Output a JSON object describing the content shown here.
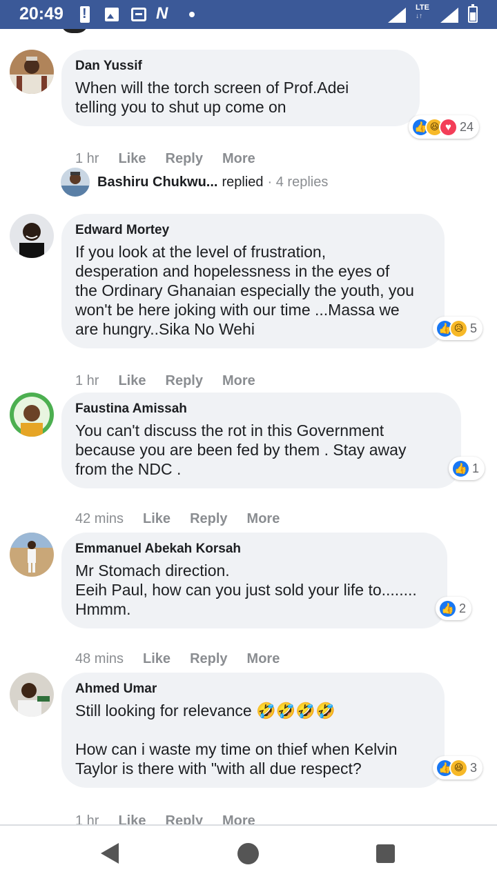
{
  "status_bar": {
    "time": "20:49",
    "network": "LTE",
    "icons": [
      "alert-icon",
      "photo-icon",
      "message-icon",
      "n-icon",
      "dot-icon",
      "signal-icon",
      "battery-icon"
    ]
  },
  "comments": [
    {
      "author": "Dan Yussif",
      "text": "When will the torch screen of Prof.Adei\ntelling you to shut up come on",
      "reactions": [
        "like",
        "haha",
        "love"
      ],
      "reaction_count": "24",
      "time": "1 hr",
      "actions": [
        "Like",
        "Reply",
        "More"
      ]
    },
    {
      "author": "Edward Mortey",
      "text": "If you look at the level of frustration,\ndesperation and hopelessness in the eyes of\nthe Ordinary Ghanaian especially the youth, you\nwon't be here joking with our time ...Massa we\nare hungry..Sika No Wehi",
      "reactions": [
        "like",
        "sad"
      ],
      "reaction_count": "5",
      "time": "1 hr",
      "actions": [
        "Like",
        "Reply",
        "More"
      ]
    },
    {
      "author": "Faustina Amissah",
      "text": "You can't discuss the rot in this Government\nbecause you are been fed by them . Stay away\nfrom the NDC .",
      "reactions": [
        "like"
      ],
      "reaction_count": "1",
      "time": "42 mins",
      "actions": [
        "Like",
        "Reply",
        "More"
      ]
    },
    {
      "author": "Emmanuel Abekah Korsah",
      "text": "Mr Stomach direction.\nEeih Paul, how can you just sold your life to........\nHmmm.",
      "reactions": [
        "like"
      ],
      "reaction_count": "2",
      "time": "48 mins",
      "actions": [
        "Like",
        "Reply",
        "More"
      ]
    },
    {
      "author": "Ahmed Umar",
      "text": "Still looking for relevance 🤣🤣🤣🤣\n\nHow can i waste my time on thief when Kelvin\nTaylor is there with \"with all due respect?",
      "reactions": [
        "like",
        "haha"
      ],
      "reaction_count": "3",
      "time": "1 hr",
      "actions": [
        "Like",
        "Reply",
        "More"
      ]
    }
  ],
  "reply_thread": {
    "name": "Bashiru Chukwu...",
    "verb": "replied",
    "count": "· 4 replies"
  },
  "colors": {
    "status_bar": "#3b5998",
    "bubble": "#f0f2f5",
    "like": "#1877f2",
    "love": "#f33e58",
    "haha": "#f7b928",
    "muted_text": "#8a8d91"
  }
}
